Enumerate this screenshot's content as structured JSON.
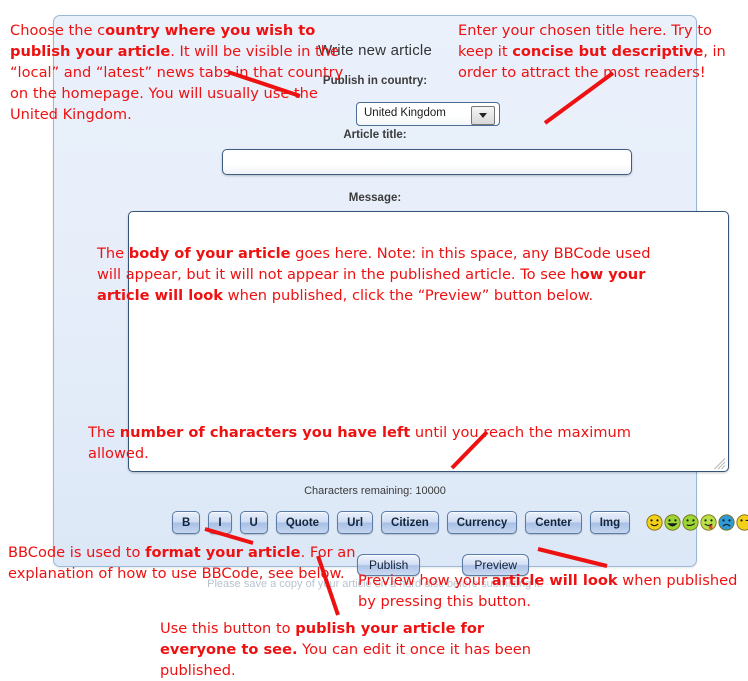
{
  "form": {
    "heading": "Write new article",
    "country_label": "Publish in country:",
    "country_value": "United Kingdom",
    "title_label": "Article title:",
    "title_value": "",
    "title_placeholder": "",
    "message_label": "Message:",
    "message_value": "",
    "characters_remaining": "Characters remaining: 10000",
    "notice": "Please save a copy of your article on a hard disc before submitting it."
  },
  "toolbar": {
    "buttons": [
      {
        "label": "B",
        "name": "bold"
      },
      {
        "label": "I",
        "name": "italic"
      },
      {
        "label": "U",
        "name": "underline"
      },
      {
        "label": "Quote",
        "name": "quote"
      },
      {
        "label": "Url",
        "name": "url"
      },
      {
        "label": "Citizen",
        "name": "citizen"
      },
      {
        "label": "Currency",
        "name": "currency"
      },
      {
        "label": "Center",
        "name": "center"
      },
      {
        "label": "Img",
        "name": "img"
      }
    ],
    "smileys": [
      {
        "name": "smiley-happy",
        "color": "#f3d019",
        "mouth": "smile"
      },
      {
        "name": "smiley-grin",
        "color": "#9bd634",
        "mouth": "grin"
      },
      {
        "name": "smiley-smirk",
        "color": "#9bd634",
        "mouth": "smirk"
      },
      {
        "name": "smiley-tongue",
        "color": "#b9e24a",
        "mouth": "tongue"
      },
      {
        "name": "smiley-sad",
        "color": "#2e9bd6",
        "mouth": "sad"
      },
      {
        "name": "smiley-wink",
        "color": "#f3d019",
        "mouth": "wink"
      }
    ]
  },
  "actions": {
    "publish_label": "Publish",
    "preview_label": "Preview"
  },
  "annotations": {
    "country": {
      "parts": [
        {
          "t": "Choose the c",
          "b": false
        },
        {
          "t": "ountry where you wish to publish your article",
          "b": true
        },
        {
          "t": ". It will be visible in the “local” and “latest” news tabs in that country on the homepage. You will usually use the United Kingdom.",
          "b": false
        }
      ]
    },
    "title": {
      "parts": [
        {
          "t": "Enter your chosen title here. Try to keep it ",
          "b": false
        },
        {
          "t": "concise but descriptive",
          "b": true
        },
        {
          "t": ", in order to attract the most readers!",
          "b": false
        }
      ]
    },
    "body": {
      "parts": [
        {
          "t": "The ",
          "b": false
        },
        {
          "t": "body of your article",
          "b": true
        },
        {
          "t": " goes here. Note: in this space, any BBCode used will appear, but it will not appear in the published article. To see h",
          "b": false
        },
        {
          "t": "ow your article will look",
          "b": true
        },
        {
          "t": " when published, click the “Preview” button below.",
          "b": false
        }
      ]
    },
    "chars": {
      "parts": [
        {
          "t": "The ",
          "b": false
        },
        {
          "t": "number of characters you have left",
          "b": true
        },
        {
          "t": " until you reach the maximum allowed.",
          "b": false
        }
      ]
    },
    "bbcode": {
      "parts": [
        {
          "t": "BBCode is used to ",
          "b": false
        },
        {
          "t": "format your article",
          "b": true
        },
        {
          "t": ". For an explanation of how to use BBCode, see below.",
          "b": false
        }
      ]
    },
    "preview": {
      "parts": [
        {
          "t": "Preview how your ",
          "b": false
        },
        {
          "t": "article will look",
          "b": true
        },
        {
          "t": " when published by pressing this button.",
          "b": false
        }
      ]
    },
    "publish": {
      "parts": [
        {
          "t": "Use this button to ",
          "b": false
        },
        {
          "t": "publish your article for everyone to see.",
          "b": true
        },
        {
          "t": " You can edit it once it has been published.",
          "b": false
        }
      ]
    }
  },
  "colors": {
    "annotation_red": "#ee1111",
    "panel_bg": "#e7eefa",
    "panel_border": "#9ab8d8",
    "button_blue": "#aec3e8"
  }
}
